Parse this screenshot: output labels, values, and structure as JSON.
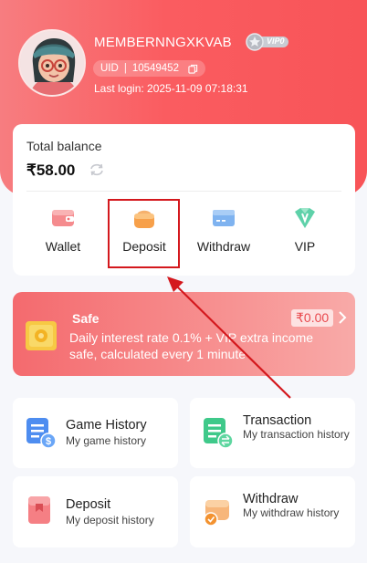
{
  "profile": {
    "username": "MEMBERNNGXKVAB",
    "vip_badge": "VIP0",
    "uid_label": "UID",
    "uid_separator": "|",
    "uid_value": "10549452",
    "last_login": "Last login: 2025-11-09 07:18:31"
  },
  "balance": {
    "label": "Total balance",
    "amount": "₹58.00"
  },
  "actions": [
    {
      "label": "Wallet",
      "icon": "wallet-icon"
    },
    {
      "label": "Deposit",
      "icon": "deposit-icon"
    },
    {
      "label": "Withdraw",
      "icon": "withdraw-icon"
    },
    {
      "label": "VIP",
      "icon": "vip-icon"
    }
  ],
  "safe": {
    "title": "Safe",
    "amount": "₹0.00",
    "description": "Daily interest rate 0.1% + VIP extra income safe, calculated every 1 minute"
  },
  "tiles": [
    {
      "title": "Game History",
      "subtitle": "My game history",
      "icon": "game-history-icon"
    },
    {
      "title": "Transaction",
      "subtitle": "My transaction history",
      "icon": "transaction-icon"
    },
    {
      "title": "Deposit",
      "subtitle": "My deposit history",
      "icon": "deposit-history-icon"
    },
    {
      "title": "Withdraw",
      "subtitle": "My withdraw history",
      "icon": "withdraw-history-icon"
    }
  ],
  "colors": {
    "header_red": "#fa5c60",
    "highlight_box": "#d4181d",
    "annotation_arrow": "#d4181d"
  }
}
